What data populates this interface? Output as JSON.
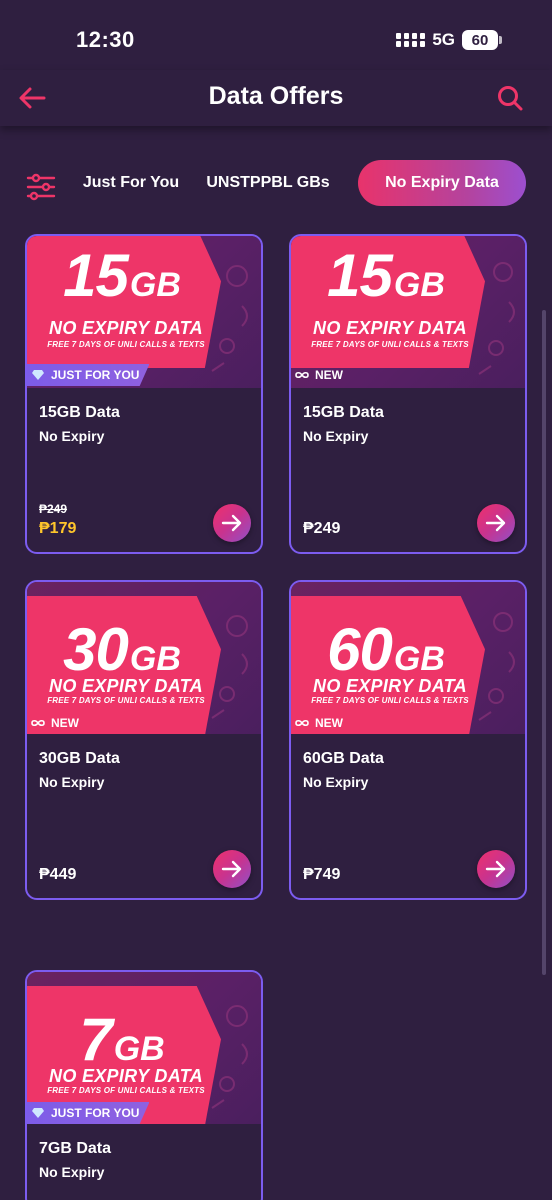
{
  "status_bar": {
    "time": "12:30",
    "network": "5G",
    "battery": "60"
  },
  "header": {
    "title": "Data Offers",
    "back_icon": "arrow-left-icon",
    "search_icon": "search-icon"
  },
  "filters": {
    "icon": "sliders-icon",
    "tabs": [
      {
        "label": "Just For You",
        "selected": false
      },
      {
        "label": "UNSTPPBL GBs",
        "selected": false
      },
      {
        "label": "No Expiry Data",
        "selected": true
      }
    ]
  },
  "offers": [
    {
      "banner_gb": "15",
      "banner_unit": "GB",
      "banner_title": "NO EXPIRY DATA",
      "banner_sub": "FREE 7 DAYS OF UNLI CALLS & TEXTS",
      "tag": "JUST FOR YOU",
      "tag_type": "jfy",
      "name": "15GB Data",
      "validity": "No Expiry",
      "old_price": "₱249",
      "price": "₱179"
    },
    {
      "banner_gb": "15",
      "banner_unit": "GB",
      "banner_title": "NO EXPIRY DATA",
      "banner_sub": "FREE 7 DAYS OF UNLI CALLS & TEXTS",
      "tag": "NEW",
      "tag_type": "new",
      "name": "15GB Data",
      "validity": "No Expiry",
      "old_price": "",
      "price": "₱249"
    },
    {
      "banner_gb": "30",
      "banner_unit": "GB",
      "banner_title": "NO EXPIRY DATA",
      "banner_sub": "FREE 7 DAYS OF UNLI CALLS & TEXTS",
      "tag": "NEW",
      "tag_type": "new",
      "name": "30GB Data",
      "validity": "No Expiry",
      "old_price": "",
      "price": "₱449"
    },
    {
      "banner_gb": "60",
      "banner_unit": "GB",
      "banner_title": "NO EXPIRY DATA",
      "banner_sub": "FREE 7 DAYS OF UNLI CALLS & TEXTS",
      "tag": "NEW",
      "tag_type": "new",
      "name": "60GB Data",
      "validity": "No Expiry",
      "old_price": "",
      "price": "₱749"
    },
    {
      "banner_gb": "7",
      "banner_unit": "GB",
      "banner_title": "NO EXPIRY DATA",
      "banner_sub": "FREE 7 DAYS OF UNLI CALLS & TEXTS",
      "tag": "JUST FOR YOU",
      "tag_type": "jfy",
      "name": "7GB Data",
      "validity": "No Expiry",
      "old_price": "",
      "price": ""
    }
  ],
  "colors": {
    "background": "#2f1f40",
    "accent": "#ee3568",
    "card_border": "#7c5cf0",
    "promo_price": "#ffc62b"
  }
}
